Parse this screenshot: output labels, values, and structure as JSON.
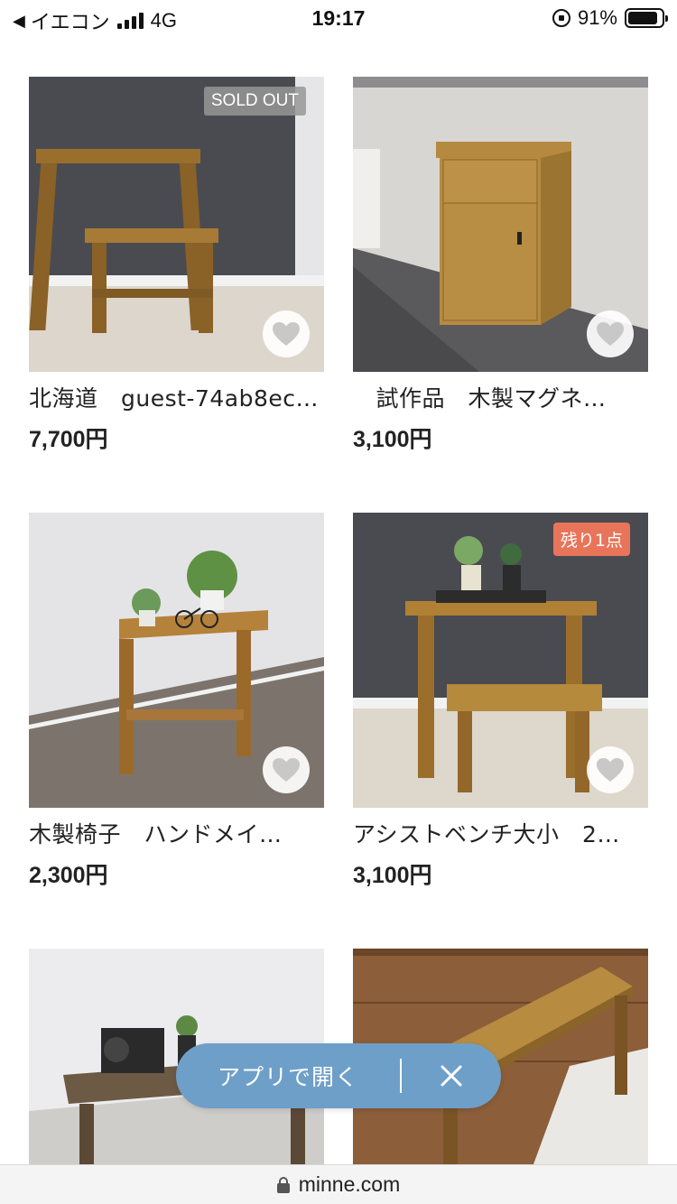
{
  "status_bar": {
    "carrier": "イエコン",
    "network": "4G",
    "time": "19:17",
    "battery": "91%"
  },
  "products": [
    {
      "name": "北海道　guest-74ab8ec…",
      "price": "7,700円",
      "badge": "SOLD OUT",
      "favorite_icon": "heart-icon"
    },
    {
      "name": "　試作品　木製マグネ…",
      "price": "3,100円",
      "badge": "",
      "favorite_icon": "heart-icon"
    },
    {
      "name": "木製椅子　ハンドメイ…",
      "price": "2,300円",
      "badge": "",
      "favorite_icon": "heart-icon"
    },
    {
      "name": "アシストベンチ大小　2…",
      "price": "3,100円",
      "badge": "残り1点",
      "favorite_icon": "heart-icon"
    }
  ],
  "app_banner": {
    "label": "アプリで開く",
    "close_icon": "close-icon",
    "background": "#6e9fc8"
  },
  "address_bar": {
    "url": "minne.com"
  },
  "colors": {
    "remain_badge": "#e8755a",
    "sold_badge": "#969696",
    "heart": "#c8c8c8"
  }
}
